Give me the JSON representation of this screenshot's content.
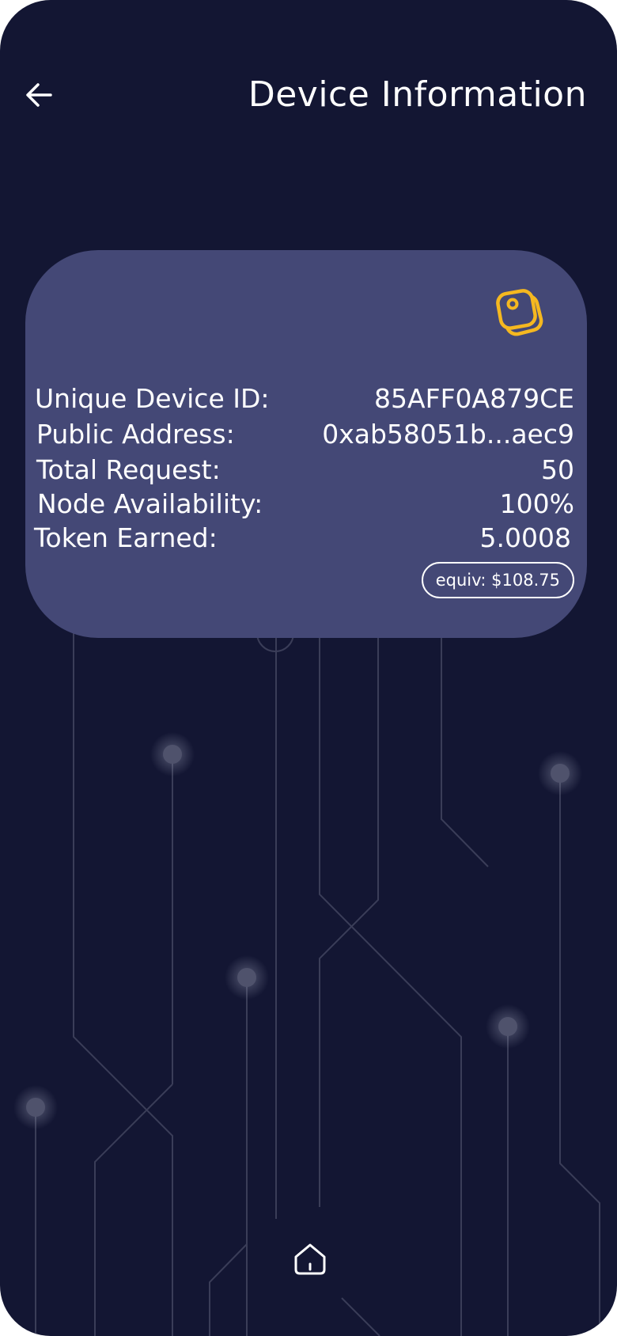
{
  "header": {
    "title": "Device Information",
    "back_icon": "arrow-left-icon"
  },
  "card": {
    "icon": "device-node-icon",
    "accent_color": "#F5B820",
    "rows": [
      {
        "label": "Unique Device ID:",
        "value": "85AFF0A879CE"
      },
      {
        "label": "Public Address:",
        "value": "0xab58051b...aec9"
      },
      {
        "label": "Total Request:",
        "value": "50"
      },
      {
        "label": "Node Availability:",
        "value": "100%"
      },
      {
        "label": "Token Earned:",
        "value": "5.0008"
      }
    ],
    "equiv": "equiv: $108.75"
  },
  "nav": {
    "home_icon": "home-icon"
  },
  "colors": {
    "background": "#131633",
    "card": "#444876",
    "text": "#FFFFFF"
  }
}
